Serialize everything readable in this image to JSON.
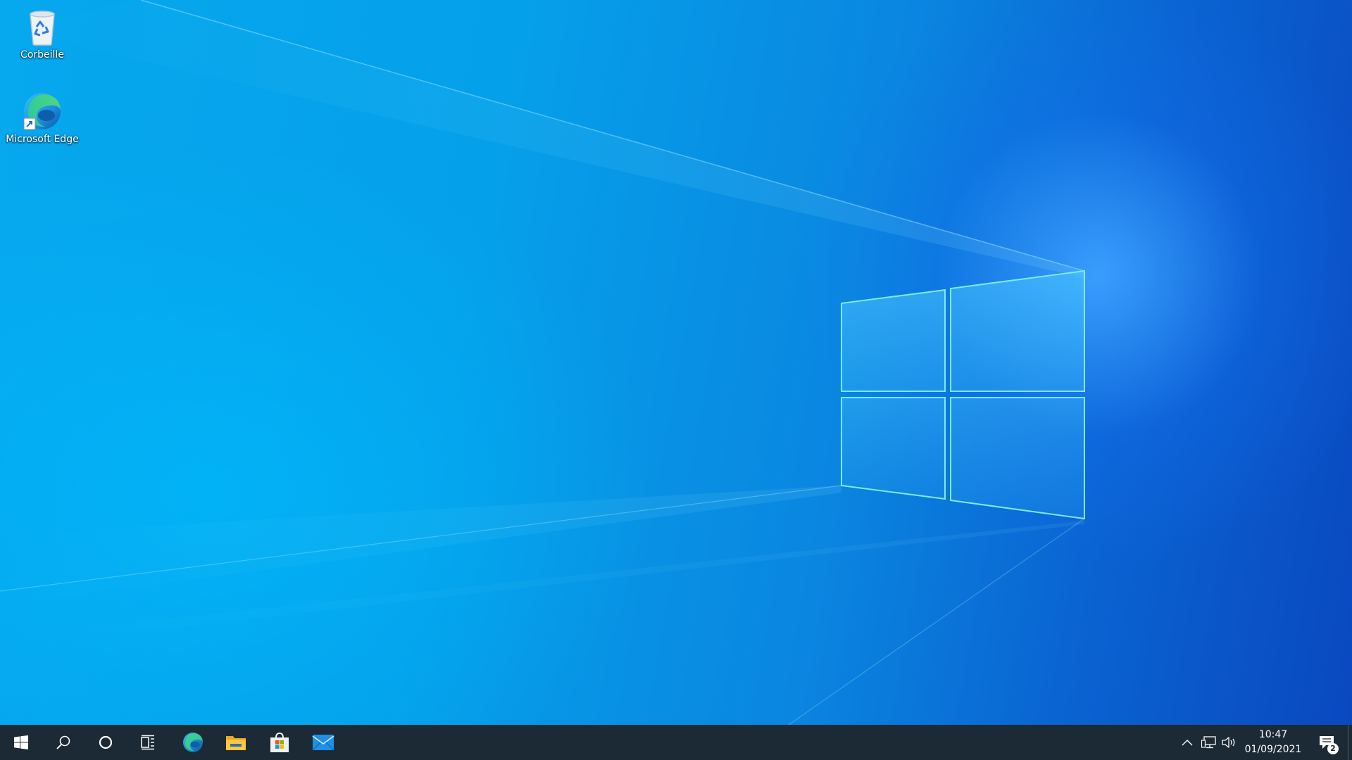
{
  "desktop": {
    "icons": [
      {
        "label": "Corbeille",
        "icon": "recycle-bin-icon"
      },
      {
        "label": "Microsoft Edge",
        "icon": "edge-icon"
      }
    ]
  },
  "taskbar": {
    "buttons": [
      {
        "name": "start-button",
        "icon": "windows-logo-icon"
      },
      {
        "name": "search-button",
        "icon": "search-icon"
      },
      {
        "name": "cortana-button",
        "icon": "circle-icon"
      },
      {
        "name": "task-view-button",
        "icon": "task-view-icon"
      },
      {
        "name": "taskbar-edge",
        "icon": "edge-icon"
      },
      {
        "name": "taskbar-file-explorer",
        "icon": "folder-icon"
      },
      {
        "name": "taskbar-microsoft-store",
        "icon": "store-bag-icon"
      },
      {
        "name": "taskbar-mail",
        "icon": "mail-icon"
      }
    ],
    "tray": {
      "icons": [
        "chevron-up-icon",
        "network-icon",
        "volume-icon"
      ],
      "time": "10:47",
      "date": "01/09/2021",
      "notification_count": "2"
    }
  },
  "colors": {
    "taskbar": "#1c2a36",
    "wallpaper_light": "#06a8ee",
    "wallpaper_dark": "#0a48c0",
    "accent": "#0078d7"
  }
}
